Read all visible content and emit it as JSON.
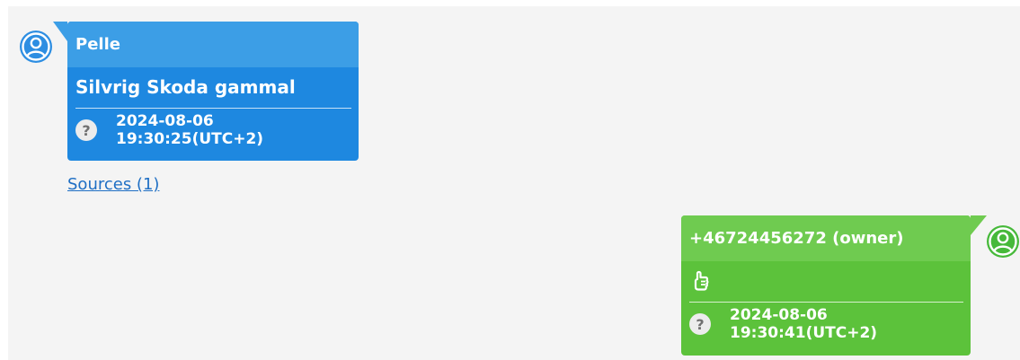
{
  "messages": {
    "incoming": {
      "sender": "Pelle",
      "text": "Silvrig Skoda gammal",
      "timestamp": "2024-08-06 19:30:25(UTC+2)",
      "status_icon": "question-icon",
      "status_glyph": "?",
      "sources_link": "Sources (1)",
      "color": "#1e88e0"
    },
    "outgoing": {
      "sender": "+46724456272 (owner)",
      "content_icon": "thumbs-up-icon",
      "timestamp": "2024-08-06 19:30:41(UTC+2)",
      "status_icon": "question-icon",
      "status_glyph": "?",
      "color": "#5cc23b"
    }
  }
}
